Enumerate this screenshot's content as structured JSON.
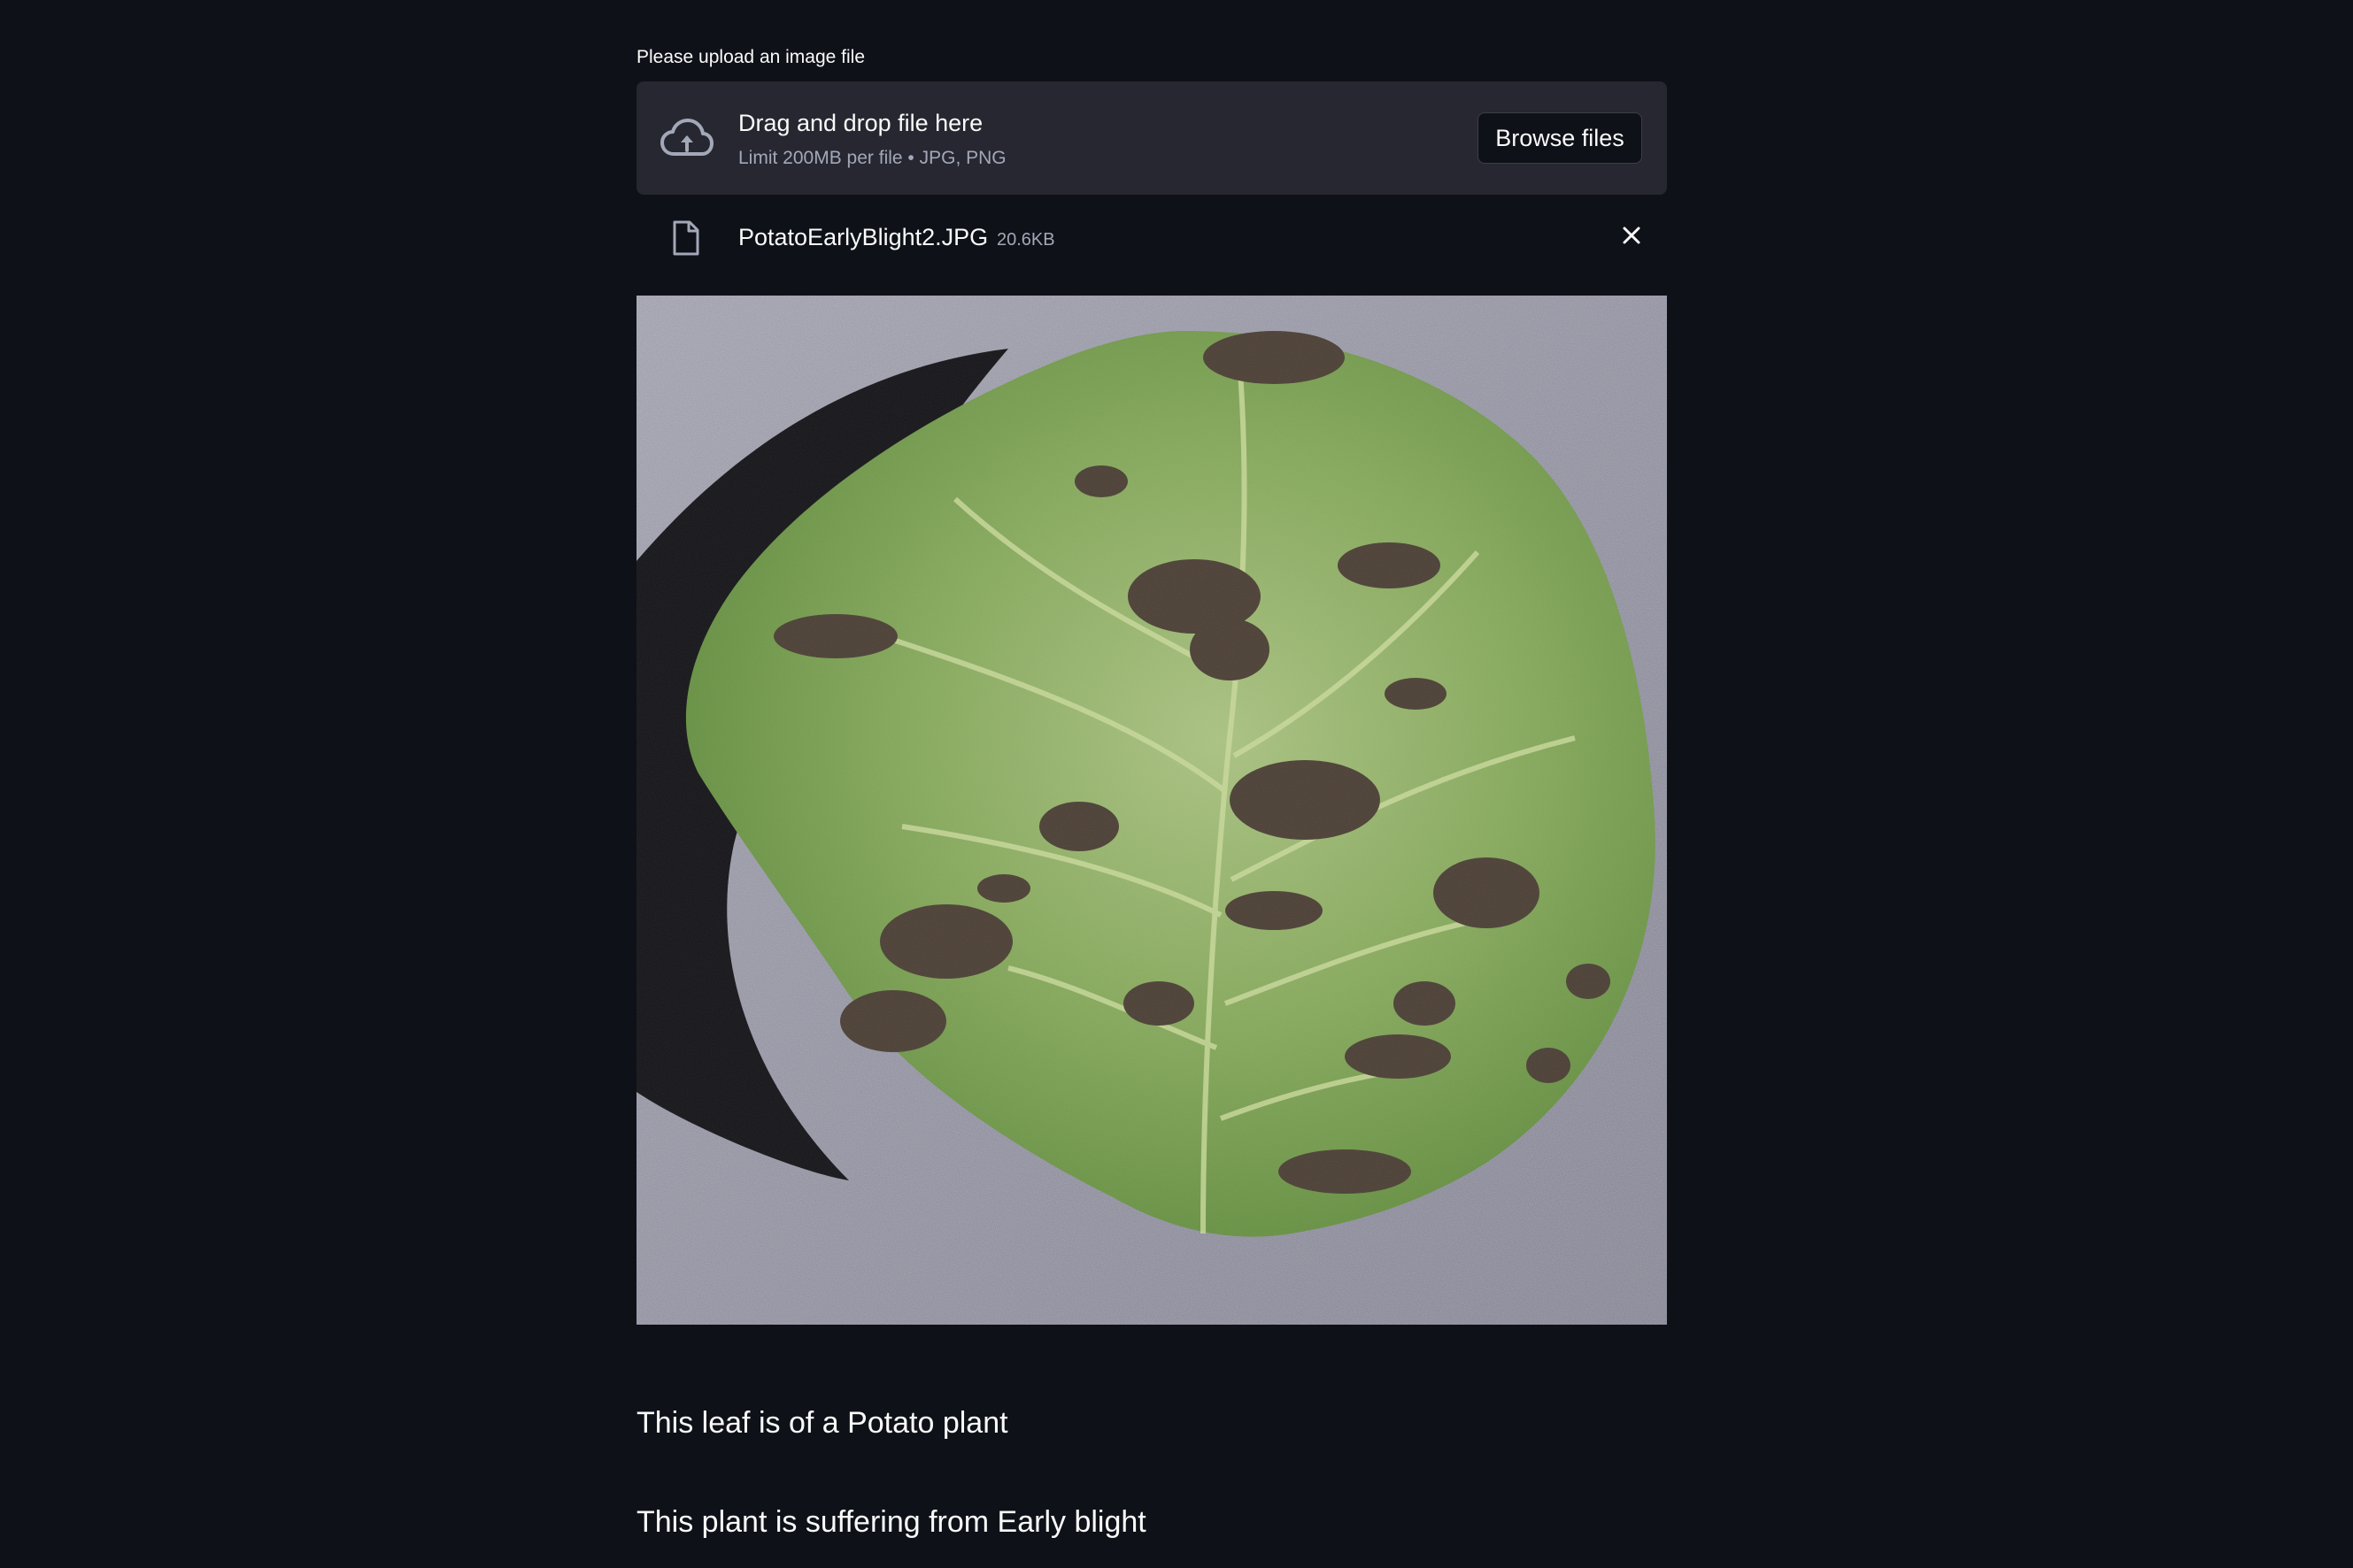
{
  "uploader": {
    "label": "Please upload an image file",
    "drop_title": "Drag and drop file here",
    "drop_subtitle": "Limit 200MB per file • JPG, PNG",
    "browse_label": "Browse files",
    "icon": "cloud-upload-icon"
  },
  "uploaded_file": {
    "name": "PotatoEarlyBlight2.JPG",
    "size": "20.6KB",
    "icon": "file-icon",
    "remove_icon": "close-icon"
  },
  "image": {
    "subject": "potato leaf with early blight lesions"
  },
  "results": {
    "plant": "This leaf is of a Potato plant",
    "disease": "This plant is suffering from Early blight"
  }
}
